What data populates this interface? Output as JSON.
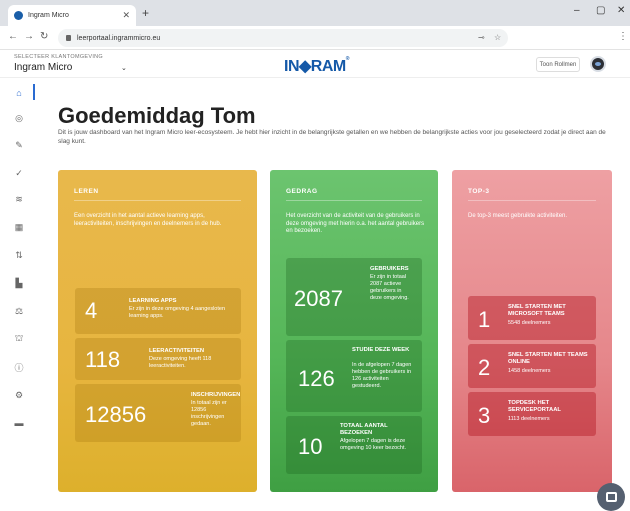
{
  "browser": {
    "tab_title": "Ingram Micro",
    "url": "leerportaal.ingrammicro.eu"
  },
  "header": {
    "selector_label": "SELECTEER KLANTOMGEVING",
    "selector_value": "Ingram Micro",
    "logo_text": "IN◆RAM",
    "logo_sup": "®",
    "action_button": "Toon Rollmen"
  },
  "sidebar": {
    "icons": [
      "home-icon",
      "target-icon",
      "pencil-icon",
      "check-icon",
      "layers-icon",
      "grid-icon",
      "transfer-icon",
      "bar-chart-icon",
      "scales-icon",
      "lock-icon",
      "info-icon",
      "gear-icon",
      "folder-icon"
    ]
  },
  "main": {
    "greeting": "Goedemiddag Tom",
    "intro": "Dit is jouw dashboard van het Ingram Micro leer-ecosysteem. Je hebt hier inzicht in de belangrijkste getallen en we hebben de belangrijkste acties voor jou geselecteerd zodat je direct aan de slag kunt."
  },
  "cards": {
    "leren": {
      "heading": "LEREN",
      "desc": "Een overzicht in het aantal actieve learning apps, leeractiviteiten, inschrijvingen en deelnemers in de hub.",
      "stats": [
        {
          "value": "4",
          "title": "LEARNING APPS",
          "desc": "Er zijn in deze omgeving 4 aangesloten learning apps."
        },
        {
          "value": "118",
          "title": "LEERACTIVITEITEN",
          "desc": "Deze omgeving heeft 118 leeractiviteiten."
        },
        {
          "value": "12856",
          "title": "INSCHRIJVINGEN",
          "desc": "In totaal zijn er 12856 inschrijvingen gedaan."
        }
      ]
    },
    "gedrag": {
      "heading": "GEDRAG",
      "desc": "Het overzicht van de activiteit van de gebruikers in deze omgeving met hierin o.a. het aantal gebruikers en bezoeken.",
      "stats": [
        {
          "value": "2087",
          "title": "GEBRUIKERS",
          "desc": "Er zijn in totaal 2087 actieve gebruikers in deze omgeving."
        },
        {
          "value": "126",
          "title": "STUDIE DEZE WEEK",
          "desc": "In de afgelopen 7 dagen hebben de gebruikers in 126 activiteiten gestudeerd."
        },
        {
          "value": "10",
          "title": "TOTAAL AANTAL BEZOEKEN",
          "desc": "Afgelopen 7 dagen is deze omgeving 10 keer bezocht."
        }
      ]
    },
    "top3": {
      "heading": "TOP-3",
      "desc": "De top-3 meest gebruikte activiteiten.",
      "items": [
        {
          "rank": "1",
          "title": "SNEL STARTEN MET MICROSOFT TEAMS",
          "desc": "5548 deelnemers"
        },
        {
          "rank": "2",
          "title": "SNEL STARTEN MET TEAMS ONLINE",
          "desc": "1458 deelnemers"
        },
        {
          "rank": "3",
          "title": "TOPDESK HET SERVICEPORTAAL",
          "desc": "1113 deelnemers"
        }
      ]
    }
  }
}
